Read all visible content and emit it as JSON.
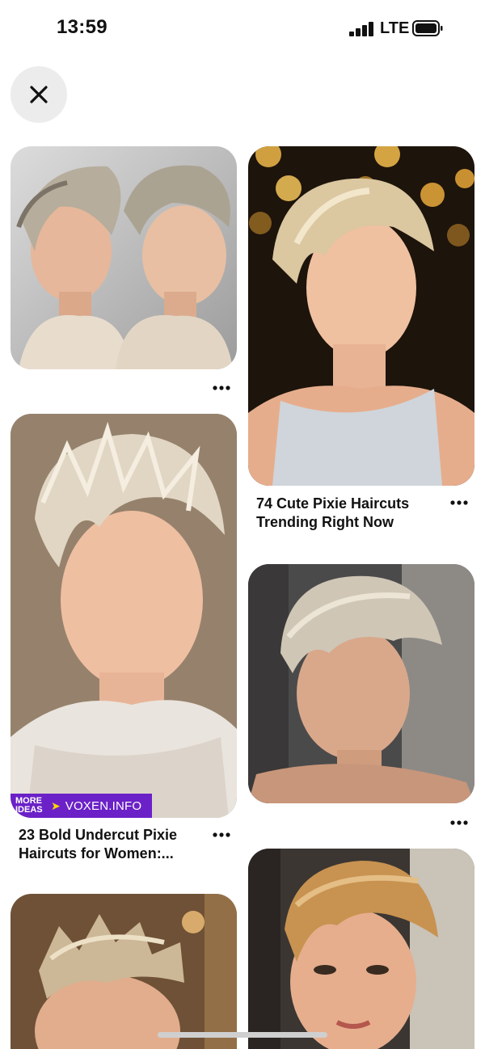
{
  "status_bar": {
    "time": "13:59",
    "network": "LTE",
    "signal_bars_filled": 4,
    "battery_level": 0.9
  },
  "close_button": {
    "icon": "close-icon"
  },
  "pins": [
    {
      "id": "pin-1",
      "title": "",
      "image": "two-profile pixie haircut"
    },
    {
      "id": "pin-2",
      "title": "74 Cute Pixie Haircuts Trending Right Now",
      "title_line1": "74 Cute Pixie Haircuts",
      "title_line2": "Trending Right Now",
      "image": "blonde pixie with bokeh lights"
    },
    {
      "id": "pin-3",
      "title": "23 Bold Undercut Pixie Haircuts for Women:...",
      "title_line1": "23 Bold Undercut Pixie",
      "title_line2": "Haircuts for Women:...",
      "image": "spiky platinum pixie",
      "attribution": {
        "more_ideas": "MORE IDEAS",
        "site": "VOXEN.INFO"
      }
    },
    {
      "id": "pin-4",
      "title": "",
      "image": "silver side-swept pixie"
    },
    {
      "id": "pin-5",
      "title": "",
      "image": "textured fauxhawk pixie"
    },
    {
      "id": "pin-6",
      "title": "",
      "image": "golden blonde pixie"
    }
  ],
  "more_icon": "more-horizontal-icon",
  "colors": {
    "accent": "#6b21c7",
    "arrow": "#ffd400",
    "close_bg": "#ececec"
  }
}
